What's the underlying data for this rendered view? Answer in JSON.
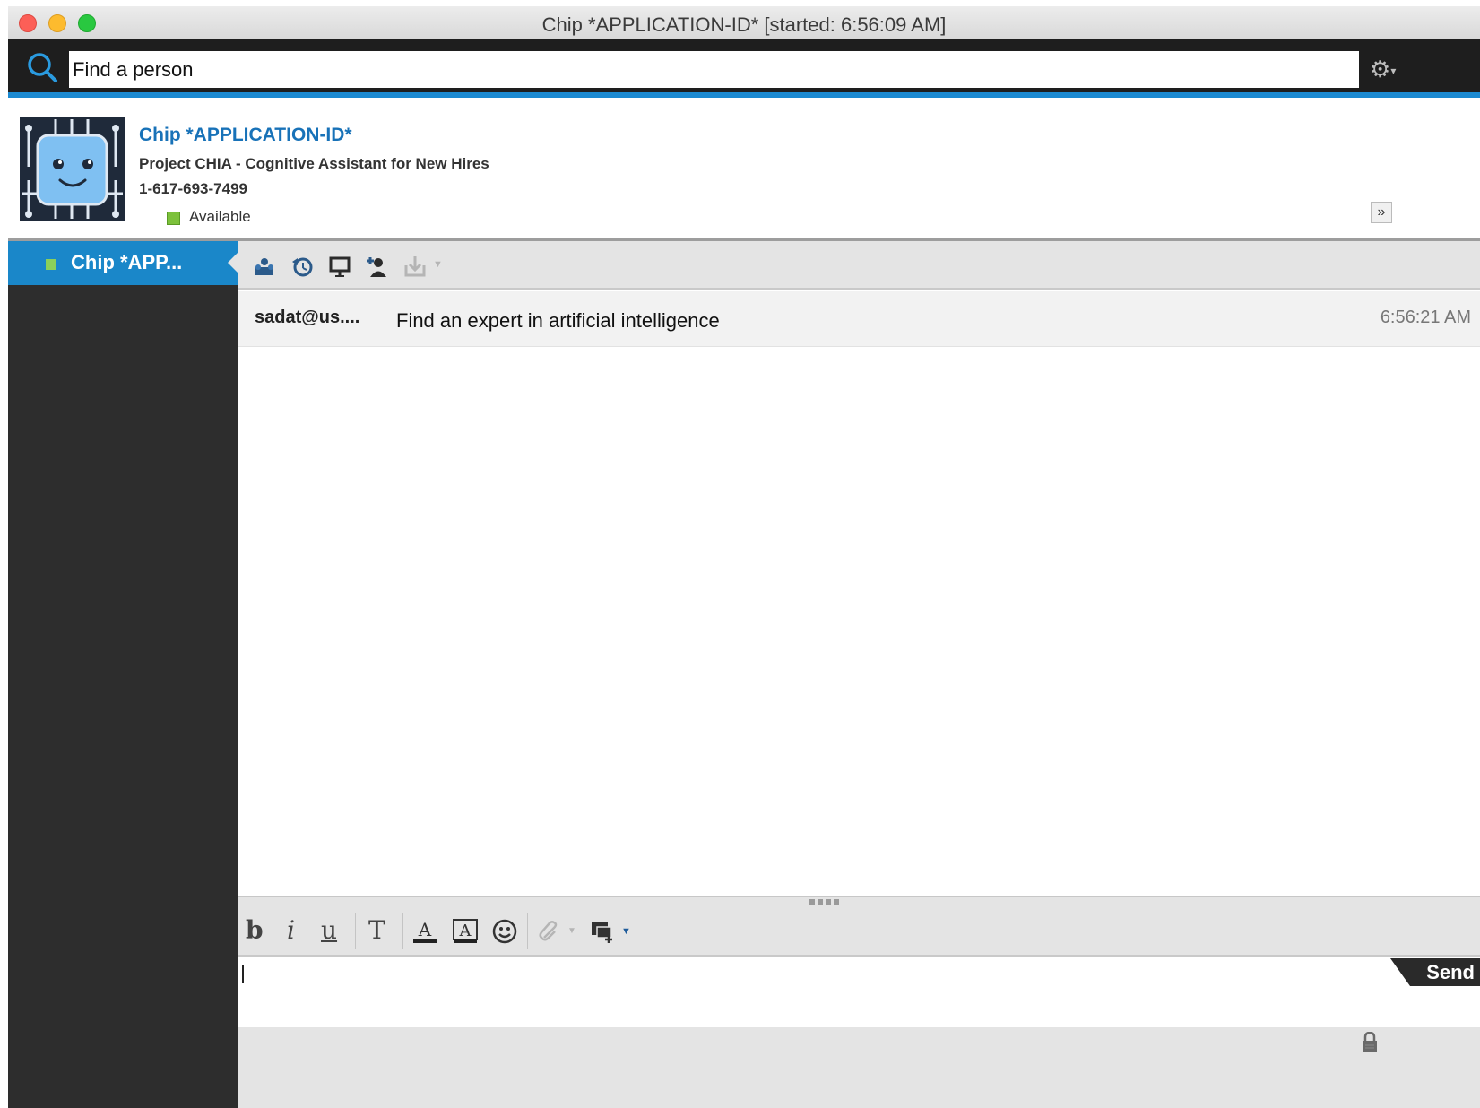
{
  "window": {
    "title": "Chip *APPLICATION-ID* [started: 6:56:09 AM]"
  },
  "search": {
    "value": "Find a person"
  },
  "card": {
    "name": "Chip *APPLICATION-ID*",
    "line1": "Project CHIA - Cognitive Assistant for New Hires",
    "line2": "1-617-693-7499",
    "status": "Available"
  },
  "sidebar": {
    "items": [
      {
        "label": "Chip *APP..."
      }
    ]
  },
  "messages": [
    {
      "sender": "sadat@us....",
      "text": "Find an expert in artificial intelligence",
      "time": "6:56:21 AM"
    }
  ],
  "format_toolbar": {
    "bold": "b",
    "italic": "i",
    "underline": "u",
    "font": "T"
  },
  "composer": {
    "send_label": "Send"
  },
  "colors": {
    "accent": "#1c8ad1",
    "selected_item": "#1a87c9",
    "status_available": "#7cc13b",
    "name_link": "#1872b8"
  }
}
